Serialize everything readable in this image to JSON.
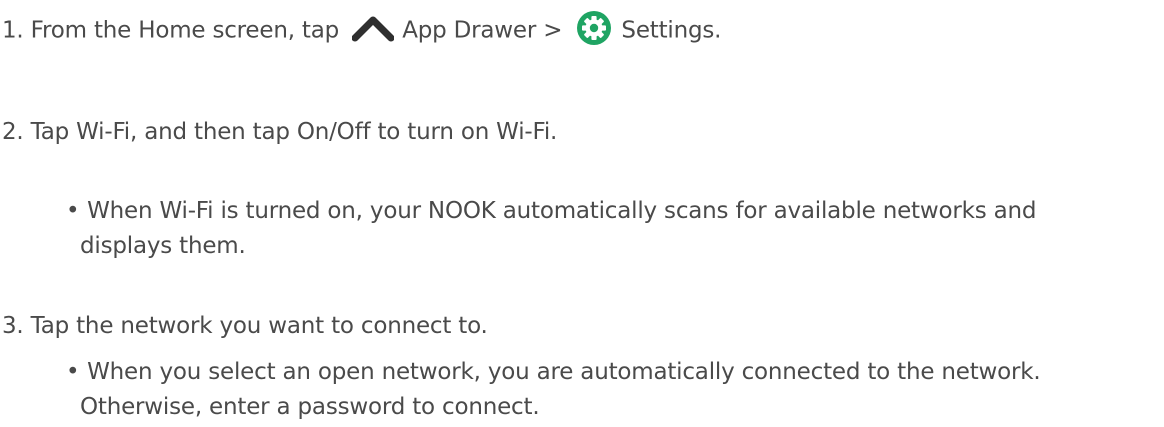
{
  "steps": [
    {
      "number": "1.",
      "text_before": "From the Home screen, tap",
      "icon_1": "chevron-up-icon",
      "label_1": "App Drawer >",
      "icon_2": "settings-gear-icon",
      "label_2": "Settings."
    },
    {
      "number": "2.",
      "text": "Tap Wi-Fi, and then tap On/Off to turn on Wi-Fi.",
      "bullet": {
        "symbol": "•",
        "line1": "When Wi-Fi is turned on, your NOOK automatically scans for available networks and",
        "line2": "displays them."
      }
    },
    {
      "number": "3.",
      "text": "Tap the network you want to connect to.",
      "bullet": {
        "symbol": "•",
        "line1": "When you select an open network, you are automatically connected to the network.",
        "line2": "Otherwise, enter a password to connect."
      }
    }
  ],
  "colors": {
    "text": "#4a4a4a",
    "chevron_icon": "#2f2f2f",
    "settings_icon_bg": "#1fa463",
    "settings_icon_fg": "#ffffff"
  }
}
